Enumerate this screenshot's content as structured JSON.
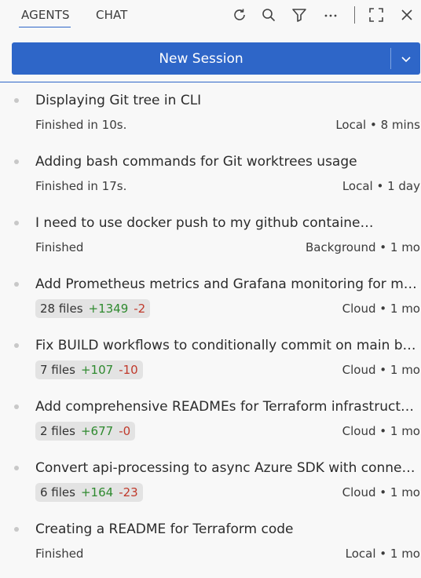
{
  "tabs": {
    "agents": "AGENTS",
    "chat": "CHAT"
  },
  "toolbar": {
    "icons": [
      "refresh-icon",
      "search-icon",
      "filter-icon",
      "more-icon",
      "maximize-icon",
      "close-icon"
    ]
  },
  "new_session": {
    "label": "New Session"
  },
  "colors": {
    "accent": "#2e66c8",
    "added": "#2f8a2f",
    "removed": "#c0392b"
  },
  "sessions": [
    {
      "title": "Displaying Git tree in CLI",
      "status": "Finished in 10s.",
      "meta": "Local • 8 mins"
    },
    {
      "title": "Adding bash commands for Git worktrees usage",
      "status": "Finished in 17s.",
      "meta": "Local • 1 day"
    },
    {
      "title": "I need to use docker push to my github containe…",
      "status": "Finished",
      "meta": "Background • 1 mo"
    },
    {
      "title": "Add Prometheus metrics and Grafana monitoring for m…",
      "files": "28 files",
      "added": "+1349",
      "removed": "-2",
      "meta": "Cloud • 1 mo"
    },
    {
      "title": "Fix BUILD workflows to conditionally commit on main b…",
      "files": "7 files",
      "added": "+107",
      "removed": "-10",
      "meta": "Cloud • 1 mo"
    },
    {
      "title": "Add comprehensive READMEs for Terraform infrastruct…",
      "files": "2 files",
      "added": "+677",
      "removed": "-0",
      "meta": "Cloud • 1 mo"
    },
    {
      "title": "Convert api-processing to async Azure SDK with conne…",
      "files": "6 files",
      "added": "+164",
      "removed": "-23",
      "meta": "Cloud • 1 mo"
    },
    {
      "title": "Creating a README for Terraform code",
      "status": "Finished",
      "meta": "Local • 1 mo"
    }
  ]
}
